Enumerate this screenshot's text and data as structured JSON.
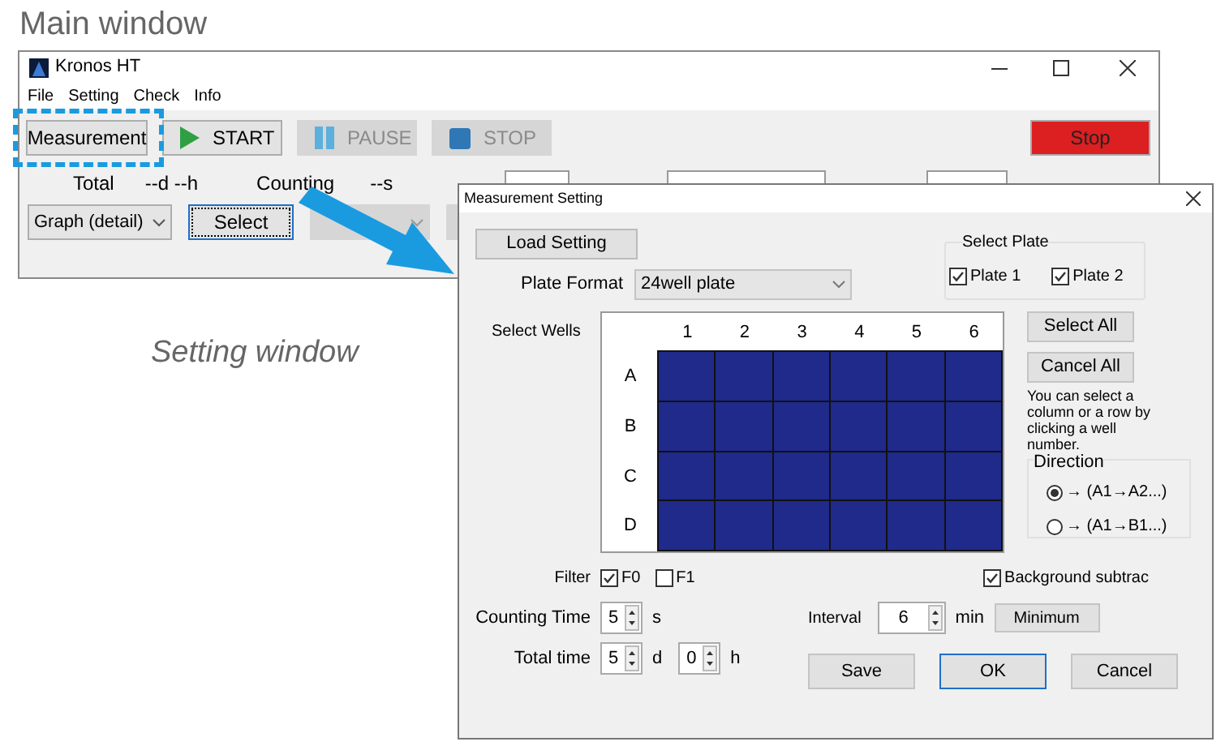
{
  "heading": "Main window",
  "caption": "Setting window",
  "main_window": {
    "title": "Kronos HT",
    "menu": [
      "File",
      "Setting",
      "Check",
      "Info"
    ],
    "toolbar": [
      {
        "label": "Measurement",
        "kind": "plain",
        "disabled": false,
        "highlighted": true
      },
      {
        "label": "START",
        "kind": "start",
        "disabled": false,
        "highlighted": false
      },
      {
        "label": "PAUSE",
        "kind": "pause",
        "disabled": true,
        "highlighted": false
      },
      {
        "label": "STOP",
        "kind": "stop",
        "disabled": true,
        "highlighted": false
      }
    ],
    "stop_button": "Stop",
    "status": [
      "Total",
      "--d --h",
      "Counting",
      "--s"
    ],
    "graph_select": "Graph (detail)",
    "select_button": "Select"
  },
  "dialog": {
    "title": "Measurement Setting",
    "load_button": "Load Setting",
    "plate_format": {
      "label": "Plate Format",
      "value": "24well plate"
    },
    "select_plate": {
      "title": "Select Plate",
      "plates": [
        {
          "label": "Plate 1",
          "checked": true
        },
        {
          "label": "Plate 2",
          "checked": true
        }
      ]
    },
    "wells": {
      "label": "Select Wells",
      "columns": [
        "1",
        "2",
        "3",
        "4",
        "5",
        "6"
      ],
      "rows": [
        {
          "label": "A",
          "wells": [
            {
              "selected": true
            },
            {
              "selected": true
            },
            {
              "selected": true
            },
            {
              "selected": true
            },
            {
              "selected": true
            },
            {
              "selected": true
            }
          ]
        },
        {
          "label": "B",
          "wells": [
            {
              "selected": true
            },
            {
              "selected": true
            },
            {
              "selected": true
            },
            {
              "selected": true
            },
            {
              "selected": true
            },
            {
              "selected": true
            }
          ]
        },
        {
          "label": "C",
          "wells": [
            {
              "selected": true
            },
            {
              "selected": true
            },
            {
              "selected": true
            },
            {
              "selected": true
            },
            {
              "selected": true
            },
            {
              "selected": true
            }
          ]
        },
        {
          "label": "D",
          "wells": [
            {
              "selected": true
            },
            {
              "selected": true
            },
            {
              "selected": true
            },
            {
              "selected": true
            },
            {
              "selected": true
            },
            {
              "selected": true
            }
          ]
        }
      ]
    },
    "side_buttons": [
      "Select All",
      "Cancel All"
    ],
    "hint": "You can select a column or a row by clicking a well number.",
    "direction": {
      "title": "Direction",
      "options": [
        {
          "label": "→ (A1→A2...)",
          "selected": true
        },
        {
          "label": "→ (A1→B1...)",
          "selected": false
        }
      ]
    },
    "filter": {
      "label": "Filter",
      "options": [
        {
          "label": "F0",
          "checked": true
        },
        {
          "label": "F1",
          "checked": false
        }
      ]
    },
    "background": {
      "label": "Background subtrac",
      "checked": true
    },
    "counting_time": {
      "label": "Counting Time",
      "fields": [
        {
          "value": "5",
          "unit": "s"
        }
      ]
    },
    "total_time": {
      "label": "Total time",
      "fields": [
        {
          "value": "5",
          "unit": "d"
        },
        {
          "value": "0",
          "unit": "h"
        }
      ]
    },
    "interval": {
      "label": "Interval",
      "value": "6",
      "unit": "min",
      "button": "Minimum"
    },
    "buttons": [
      {
        "label": "Save",
        "default": false
      },
      {
        "label": "OK",
        "default": true
      },
      {
        "label": "Cancel",
        "default": false
      }
    ]
  }
}
